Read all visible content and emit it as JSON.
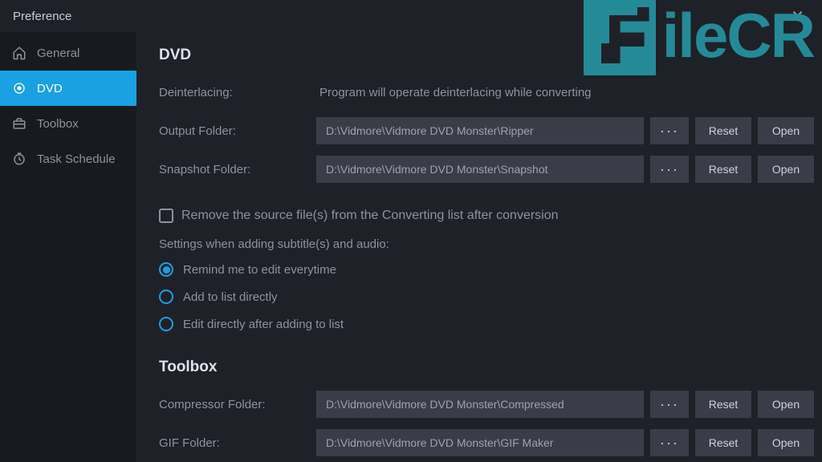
{
  "window": {
    "title": "Preference"
  },
  "sidebar": {
    "items": [
      {
        "label": "General",
        "icon": "home-icon"
      },
      {
        "label": "DVD",
        "icon": "dot-icon"
      },
      {
        "label": "Toolbox",
        "icon": "toolbox-icon"
      },
      {
        "label": "Task Schedule",
        "icon": "clock-icon"
      }
    ]
  },
  "dvd": {
    "section_title": "DVD",
    "deinterlacing_label": "Deinterlacing:",
    "deinterlacing_info": "Program will operate deinterlacing while converting",
    "output_folder_label": "Output Folder:",
    "output_folder_path": "D:\\Vidmore\\Vidmore DVD Monster\\Ripper",
    "snapshot_folder_label": "Snapshot Folder:",
    "snapshot_folder_path": "D:\\Vidmore\\Vidmore DVD Monster\\Snapshot",
    "browse_label": "···",
    "reset_label": "Reset",
    "open_label": "Open",
    "remove_source_label": "Remove the source file(s) from the Converting list after conversion",
    "subtitle_settings_caption": "Settings when adding subtitle(s) and audio:",
    "radio_options": [
      "Remind me to edit everytime",
      "Add to list directly",
      "Edit directly after adding to list"
    ]
  },
  "toolbox": {
    "section_title": "Toolbox",
    "compressor_folder_label": "Compressor Folder:",
    "compressor_folder_path": "D:\\Vidmore\\Vidmore DVD Monster\\Compressed",
    "gif_folder_label": "GIF Folder:",
    "gif_folder_path": "D:\\Vidmore\\Vidmore DVD Monster\\GIF Maker"
  },
  "watermark": {
    "text": "ileCR"
  }
}
